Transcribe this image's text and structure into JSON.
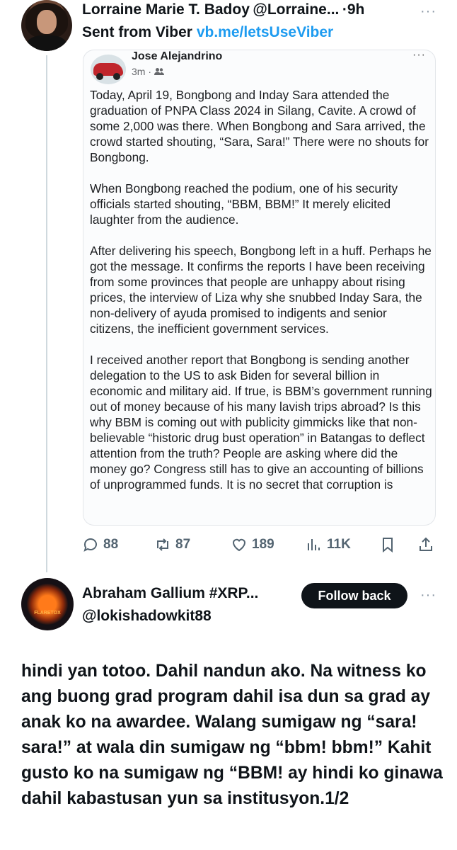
{
  "tweet1": {
    "display_name": "Lorraine Marie T. Badoy",
    "handle": "@Lorraine...",
    "separator": "·",
    "time": "9h",
    "more": "···",
    "text_prefix": "Sent from Viber",
    "link": "vb.me/letsUseViber"
  },
  "embedded_post": {
    "author": "Jose Alejandrino",
    "meta": "3m ·",
    "more": "···",
    "paragraphs": [
      "Today, April 19, Bongbong and Inday Sara attended the graduation of PNPA Class 2024 in Silang, Cavite. A crowd of some 2,000 was there. When Bongbong and Sara arrived, the crowd started shouting, “Sara, Sara!” There were no shouts for Bongbong.",
      "When Bongbong reached the podium, one of his security officials started shouting, “BBM, BBM!” It merely elicited laughter from the audience.",
      "After delivering his speech, Bongbong left in a huff. Perhaps he got the message. It confirms the reports I have been receiving from some provinces that people are unhappy about rising prices, the interview of Liza why she snubbed Inday Sara, the non-delivery of ayuda promised to indigents and senior citizens, the inefficient government services.",
      "I received another report that Bongbong is sending another delegation to the US to ask Biden for several billion in economic and military aid. If true, is BBM’s government running out of money because of his many lavish trips abroad? Is this why BBM is coming out with publicity gimmicks like that non-believable “historic drug bust operation” in Batangas to deflect attention from the truth? People are asking where did the money go? Congress still has to give an accounting of billions of unprogrammed funds. It is no secret that corruption is"
    ]
  },
  "actions": {
    "replies": "88",
    "reposts": "87",
    "likes": "189",
    "views": "11K"
  },
  "tweet2": {
    "display_name": "Abraham Gallium #XRP...",
    "handle": "@lokishadowkit88",
    "follow_label": "Follow back",
    "more": "···",
    "avatar_text": "FLARETOX",
    "text": "hindi yan totoo. Dahil nandun ako. Na witness ko ang buong grad program dahil isa dun sa grad ay anak ko na awardee. Walang sumigaw ng “sara! sara!” at wala din sumigaw ng “bbm! bbm!” Kahit gusto ko na sumigaw ng “BBM! ay hindi ko ginawa dahil kabastusan yun sa institusyon.1/2"
  },
  "colors": {
    "link": "#1d9bf0",
    "text": "#0f1419",
    "muted": "#536471",
    "button_bg": "#0f1419"
  },
  "icons": [
    "reply-icon",
    "repost-icon",
    "like-icon",
    "views-icon",
    "bookmark-icon",
    "share-icon",
    "friends-icon",
    "more-icon"
  ]
}
